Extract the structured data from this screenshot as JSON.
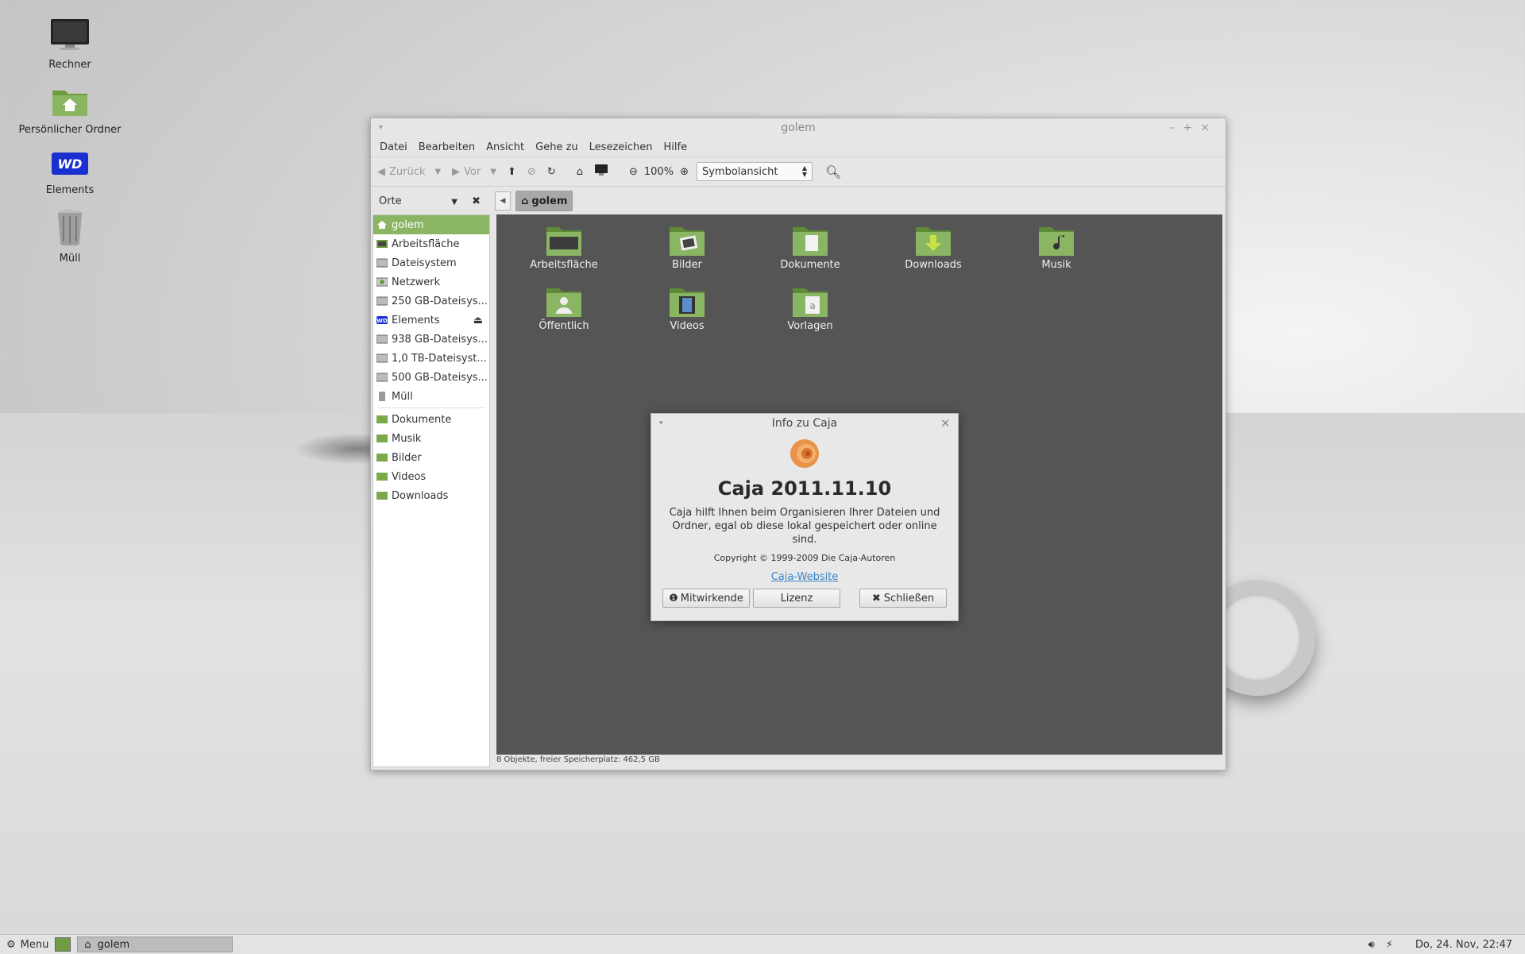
{
  "desktop": {
    "icons": [
      {
        "label": "Rechner",
        "icon": "computer-icon"
      },
      {
        "label": "Persönlicher Ordner",
        "icon": "home-folder-icon"
      },
      {
        "label": "Elements",
        "icon": "wd-drive-icon"
      },
      {
        "label": "Müll",
        "icon": "trash-icon"
      }
    ]
  },
  "window": {
    "title": "golem",
    "menu": [
      "Datei",
      "Bearbeiten",
      "Ansicht",
      "Gehe zu",
      "Lesezeichen",
      "Hilfe"
    ],
    "toolbar": {
      "back_label": "Zurück",
      "forward_label": "Vor",
      "zoom": "100%",
      "view_mode": "Symbolansicht"
    },
    "side_header": "Orte",
    "breadcrumb": "golem",
    "sidebar": {
      "places": [
        {
          "label": "golem",
          "icon": "home-icon",
          "selected": true
        },
        {
          "label": "Arbeitsfläche",
          "icon": "desktop-icon"
        },
        {
          "label": "Dateisystem",
          "icon": "drive-icon"
        },
        {
          "label": "Netzwerk",
          "icon": "network-icon"
        },
        {
          "label": "250 GB-Dateisys...",
          "icon": "drive-icon"
        },
        {
          "label": "Elements",
          "icon": "wd-drive-icon",
          "eject": true
        },
        {
          "label": "938 GB-Dateisys...",
          "icon": "drive-icon"
        },
        {
          "label": "1,0 TB-Dateisyst...",
          "icon": "drive-icon"
        },
        {
          "label": "500 GB-Dateisys...",
          "icon": "drive-icon"
        },
        {
          "label": "Müll",
          "icon": "trash-icon"
        }
      ],
      "bookmarks": [
        {
          "label": "Dokumente",
          "icon": "folder-icon"
        },
        {
          "label": "Musik",
          "icon": "folder-icon"
        },
        {
          "label": "Bilder",
          "icon": "folder-icon"
        },
        {
          "label": "Videos",
          "icon": "folder-icon"
        },
        {
          "label": "Downloads",
          "icon": "folder-icon"
        }
      ]
    },
    "files": [
      {
        "label": "Arbeitsfläche",
        "emblem": "desktop"
      },
      {
        "label": "Bilder",
        "emblem": "pictures"
      },
      {
        "label": "Dokumente",
        "emblem": "documents"
      },
      {
        "label": "Downloads",
        "emblem": "download"
      },
      {
        "label": "Musik",
        "emblem": "music"
      },
      {
        "label": "Öffentlich",
        "emblem": "public"
      },
      {
        "label": "Videos",
        "emblem": "video"
      },
      {
        "label": "Vorlagen",
        "emblem": "templates"
      }
    ],
    "status": "8 Objekte, freier Speicherplatz: 462,5 GB"
  },
  "dialog": {
    "title": "Info zu Caja",
    "app_name": "Caja 2011.11.10",
    "description": "Caja hilft Ihnen beim Organisieren Ihrer Dateien und Ordner, egal ob diese lokal gespeichert oder online sind.",
    "copyright": "Copyright © 1999-2009 Die Caja-Autoren",
    "website": "Caja-Website",
    "buttons": {
      "credits": "Mitwirkende",
      "license": "Lizenz",
      "close": "Schließen"
    }
  },
  "taskbar": {
    "menu_label": "Menu",
    "task_label": "golem",
    "clock": "Do, 24. Nov, 22:47"
  },
  "colors": {
    "accent": "#8ab563",
    "content_bg": "#555555",
    "folder": "#7aa84a"
  }
}
